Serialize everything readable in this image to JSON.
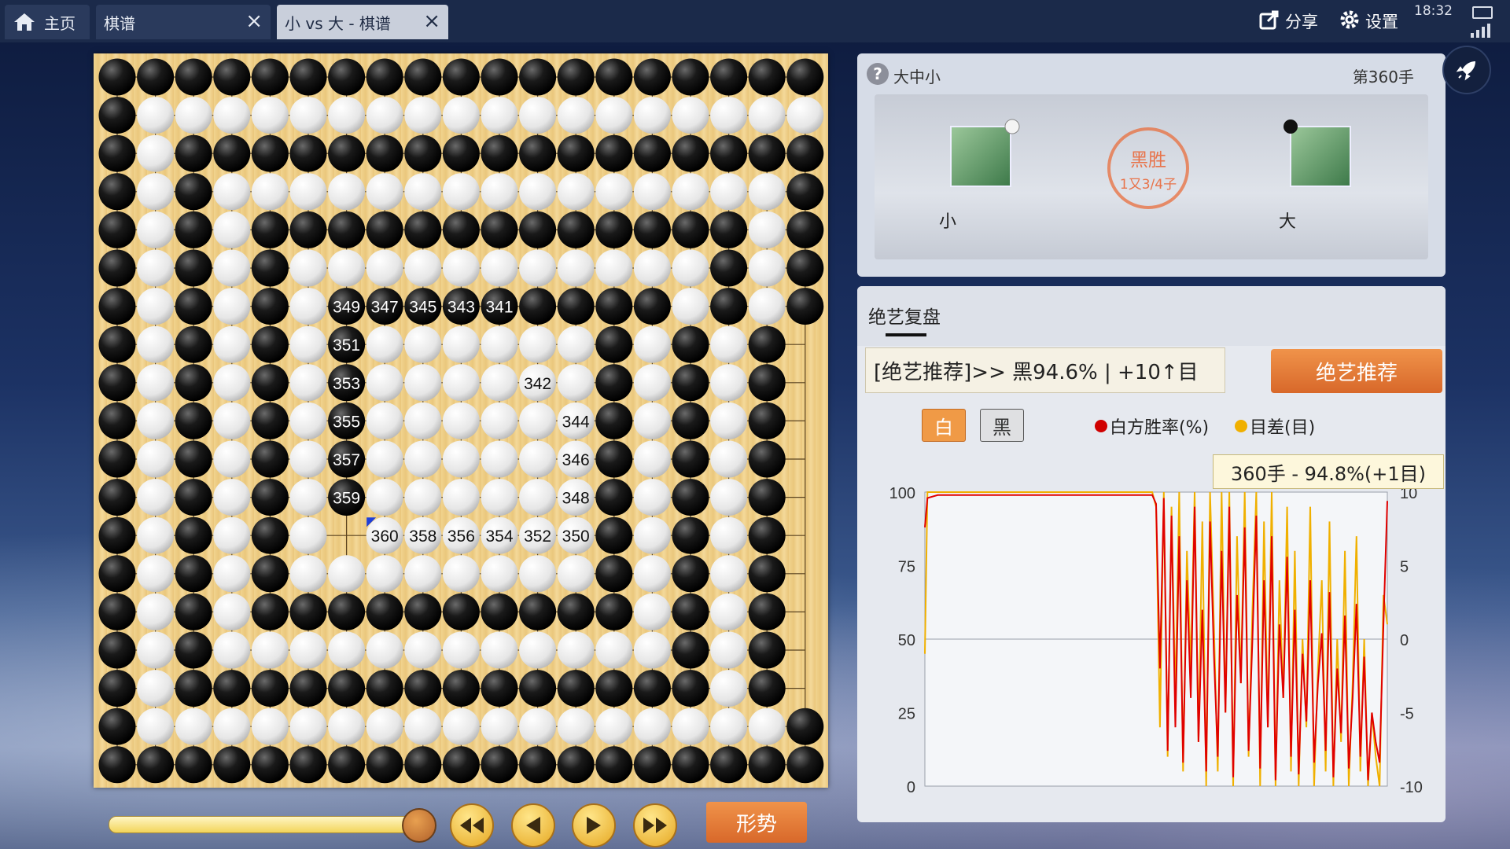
{
  "tabs": [
    {
      "label": "主页",
      "icon": "home-icon"
    },
    {
      "label": "棋谱"
    },
    {
      "label": "小 vs 大 - 棋谱",
      "active": true
    }
  ],
  "topbar": {
    "share_label": "分享",
    "settings_label": "设置",
    "clock": "18:32"
  },
  "game": {
    "title": "大中小",
    "move_label": "第360手",
    "white_player": "小",
    "black_player": "大",
    "result_main": "黑胜",
    "result_sub": "1又3/4子"
  },
  "analysis": {
    "tab_label": "绝艺复盘",
    "recommendation_text": "[绝艺推荐]>> 黑94.6% | +10↑目",
    "recommend_button": "绝艺推荐",
    "toggle_white": "白",
    "toggle_black": "黑",
    "legend_winrate": "白方胜率(%)",
    "legend_score": "目差(目)",
    "tooltip": "360手 - 94.8%(+1目)"
  },
  "controls": {
    "trend_button": "形势",
    "progress": 1.0
  },
  "board": {
    "size": 19,
    "rows": [
      "BBBBBBBBBBBBBBBBBBB",
      "BWWWWWWWWWWWWWWWWWW",
      "BWBBBBBBBBBBBBBBBBB",
      "BWBWWWWWWWWWWWWWWWB",
      "BWBWBBBBBBBBBBBBBWB",
      "BWBWBWWWWWWWWWWWBWB",
      "BWBWBWBBBBBBBBBWBWB",
      "BWBWBWBWWWWWWBWBWB",
      "BWBWBWBWWWWWWBWBWB",
      "BWBWBWBWWWWWWBWBWB",
      "BWBWBWBWWWWWWBWBWB",
      "BWBWBWBWWWWWWBWBWB",
      "BWBWBW.WWWWWWBWBWB",
      "BWBWBWWWWWWWWBWBWB",
      "BWBWBBBBBBBBBBWBWB",
      "BWBWWWWWWWWWWWWBWB",
      "BWBBBBBBBBBBBBBBWB",
      "BWWWWWWWWWWWWWWWWWB",
      "BBBBBBBBBBBBBBBBBBB"
    ],
    "labels": [
      {
        "r": 6,
        "c": 6,
        "t": "349"
      },
      {
        "r": 6,
        "c": 7,
        "t": "347"
      },
      {
        "r": 6,
        "c": 8,
        "t": "345"
      },
      {
        "r": 6,
        "c": 9,
        "t": "343"
      },
      {
        "r": 6,
        "c": 10,
        "t": "341"
      },
      {
        "r": 7,
        "c": 6,
        "t": "351"
      },
      {
        "r": 8,
        "c": 6,
        "t": "353"
      },
      {
        "r": 9,
        "c": 6,
        "t": "355"
      },
      {
        "r": 10,
        "c": 6,
        "t": "357"
      },
      {
        "r": 11,
        "c": 6,
        "t": "359"
      },
      {
        "r": 8,
        "c": 11,
        "t": "342"
      },
      {
        "r": 9,
        "c": 12,
        "t": "344"
      },
      {
        "r": 10,
        "c": 12,
        "t": "346"
      },
      {
        "r": 11,
        "c": 12,
        "t": "348"
      },
      {
        "r": 12,
        "c": 7,
        "t": "360"
      },
      {
        "r": 12,
        "c": 8,
        "t": "358"
      },
      {
        "r": 12,
        "c": 9,
        "t": "356"
      },
      {
        "r": 12,
        "c": 10,
        "t": "354"
      },
      {
        "r": 12,
        "c": 11,
        "t": "352"
      },
      {
        "r": 12,
        "c": 12,
        "t": "350"
      }
    ],
    "last_move": {
      "r": 12,
      "c": 7
    }
  },
  "chart_data": {
    "type": "line",
    "xlabel": "",
    "ylabel_left": "",
    "ylabel_right": "",
    "y_left_ticks": [
      "100",
      "75",
      "50",
      "25",
      "0"
    ],
    "y_right_ticks": [
      "10",
      "5",
      "0",
      "-5",
      "-10"
    ],
    "ylim_left": [
      0,
      100
    ],
    "ylim_right": [
      -10,
      10
    ],
    "xlim": [
      0,
      360
    ],
    "grid": "horizontal-50",
    "series": [
      {
        "name": "白方胜率(%)",
        "color": "#e00000",
        "x": [
          0,
          2,
          10,
          60,
          100,
          140,
          177,
          180,
          183,
          186,
          189,
          192,
          195,
          198,
          201,
          204,
          207,
          210,
          213,
          216,
          219,
          222,
          225,
          228,
          231,
          234,
          237,
          240,
          243,
          246,
          249,
          252,
          255,
          258,
          261,
          264,
          267,
          270,
          273,
          276,
          279,
          282,
          285,
          288,
          291,
          294,
          297,
          300,
          303,
          306,
          309,
          312,
          315,
          318,
          321,
          324,
          327,
          330,
          333,
          336,
          339,
          342,
          345,
          348,
          351,
          354,
          357,
          360
        ],
        "y": [
          88,
          98,
          99,
          99,
          99,
          99,
          99,
          96,
          40,
          98,
          12,
          92,
          20,
          85,
          8,
          70,
          30,
          95,
          15,
          60,
          5,
          90,
          45,
          10,
          80,
          25,
          95,
          3,
          65,
          35,
          88,
          12,
          50,
          92,
          6,
          70,
          20,
          85,
          2,
          55,
          30,
          78,
          10,
          60,
          4,
          45,
          22,
          70,
          8,
          35,
          52,
          12,
          66,
          3,
          40,
          18,
          58,
          6,
          30,
          62,
          10,
          44,
          2,
          25,
          15,
          8,
          55,
          97
        ]
      },
      {
        "name": "目差(目)",
        "color": "#f0b000",
        "x": [
          0,
          2,
          10,
          60,
          100,
          140,
          177,
          180,
          183,
          186,
          189,
          192,
          195,
          198,
          201,
          204,
          207,
          210,
          213,
          216,
          219,
          222,
          225,
          228,
          231,
          234,
          237,
          240,
          243,
          246,
          249,
          252,
          255,
          258,
          261,
          264,
          267,
          270,
          273,
          276,
          279,
          282,
          285,
          288,
          291,
          294,
          297,
          300,
          303,
          306,
          309,
          312,
          315,
          318,
          321,
          324,
          327,
          330,
          333,
          336,
          339,
          342,
          345,
          348,
          351,
          354,
          357,
          360
        ],
        "y": [
          -1,
          10,
          10,
          10,
          10,
          10,
          10,
          9,
          -6,
          10,
          -8,
          9,
          -4,
          10,
          -9,
          6,
          -2,
          10,
          -7,
          8,
          -10,
          10,
          1,
          -9,
          10,
          -5,
          10,
          -10,
          7,
          -3,
          10,
          -8,
          2,
          10,
          -10,
          8,
          -6,
          10,
          -10,
          4,
          -4,
          9,
          -9,
          6,
          -10,
          0,
          -6,
          9,
          -10,
          -2,
          4,
          -9,
          8,
          -10,
          0,
          -7,
          6,
          -10,
          -3,
          7,
          -9,
          0,
          -10,
          -5,
          -8,
          -10,
          3,
          1
        ]
      }
    ]
  }
}
